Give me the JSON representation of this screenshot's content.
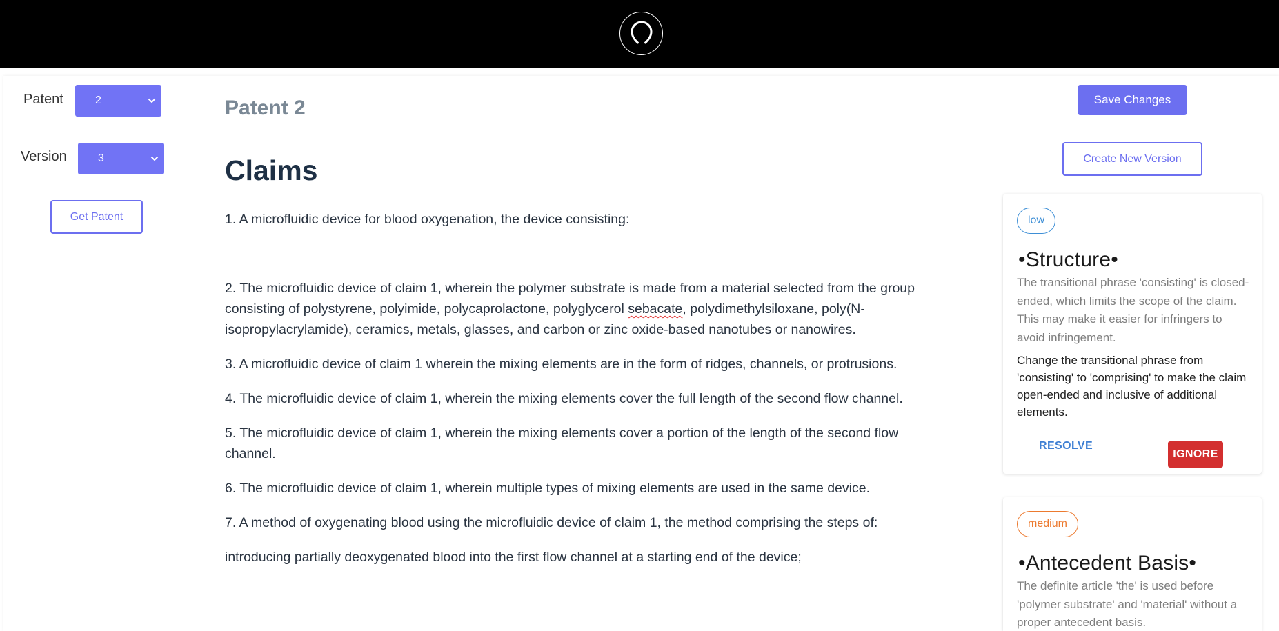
{
  "sidebar": {
    "patent_label": "Patent",
    "patent_value": "2",
    "version_label": "Version",
    "version_value": "3",
    "get_patent_label": "Get Patent"
  },
  "main": {
    "patent_title": "Patent 2",
    "claims_title": "Claims",
    "claims": [
      "1. A microfluidic device for blood oxygenation, the device consisting:",
      "2. The microfluidic device of claim 1, wherein the polymer substrate is made from a material selected from the group consisting of polystyrene, polyimide, polycaprolactone, polyglycerol ",
      "sebacate",
      ", polydimethylsiloxane, poly(N-isopropylacrylamide), ceramics, metals, glasses, and carbon or zinc oxide-based nanotubes or nanowires.",
      "3. A microfluidic device of claim 1 wherein the mixing elements are in the form of ridges, channels, or protrusions.",
      "4. The microfluidic device of claim 1, wherein the mixing elements cover the full length of the second flow channel.",
      "5. The microfluidic device of claim 1, wherein the mixing elements cover a portion of the length of the second flow channel.",
      "6. The microfluidic device of claim 1, wherein multiple types of mixing elements are used in the same device.",
      "7. A method of oxygenating blood using the microfluidic device of claim 1, the method comprising the steps of:",
      "introducing partially deoxygenated blood into the first flow channel at a starting end of the device;"
    ]
  },
  "actions": {
    "save_label": "Save Changes",
    "new_version_label": "Create New Version"
  },
  "cards": [
    {
      "severity": "low",
      "title": "•Structure•",
      "description": "The transitional phrase 'consisting' is closed-ended, which limits the scope of the claim. This may make it easier for infringers to avoid infringement.",
      "suggestion": "Change the transitional phrase from 'consisting' to 'comprising' to make the claim open-ended and inclusive of additional elements.",
      "resolve_label": "RESOLVE",
      "ignore_label": "IGNORE"
    },
    {
      "severity": "medium",
      "title": "•Antecedent Basis•",
      "description": "The definite article 'the' is used before 'polymer substrate' and 'material' without a proper antecedent basis."
    }
  ],
  "colors": {
    "accent": "#6c6ff0",
    "low": "#3e8fd6",
    "medium": "#ec7a2f",
    "ignore": "#d32f2f"
  }
}
